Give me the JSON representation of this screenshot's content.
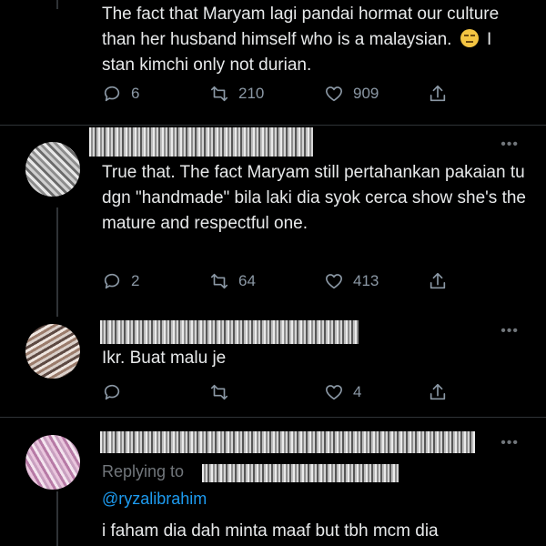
{
  "tweets": [
    {
      "text": "The fact that Maryam lagi pandai hormat our culture than her husband himself who is a malaysian.",
      "text_after_emoji": "I stan kimchi only not durian.",
      "replies": "6",
      "retweets": "210",
      "likes": "909"
    },
    {
      "text": "True that. The fact Maryam still pertahankan pakaian tu dgn \"handmade\" bila laki dia syok cerca show she's the mature and respectful one.",
      "replies": "2",
      "retweets": "64",
      "likes": "413"
    },
    {
      "text": "Ikr. Buat malu je",
      "replies": "",
      "retweets": "",
      "likes": "4"
    },
    {
      "replying_to_label": "Replying to",
      "mention": "@ryzalibrahim",
      "text": "i faham dia dah minta maaf but tbh mcm dia"
    }
  ],
  "more_glyph": "•••",
  "icons": {
    "reply": "reply-icon",
    "retweet": "retweet-icon",
    "like": "heart-icon",
    "share": "share-icon"
  },
  "colors": {
    "background": "#000000",
    "text": "#e7e9ea",
    "muted": "#8b98a5",
    "link": "#1d9bf0",
    "divider": "#2f3336"
  }
}
